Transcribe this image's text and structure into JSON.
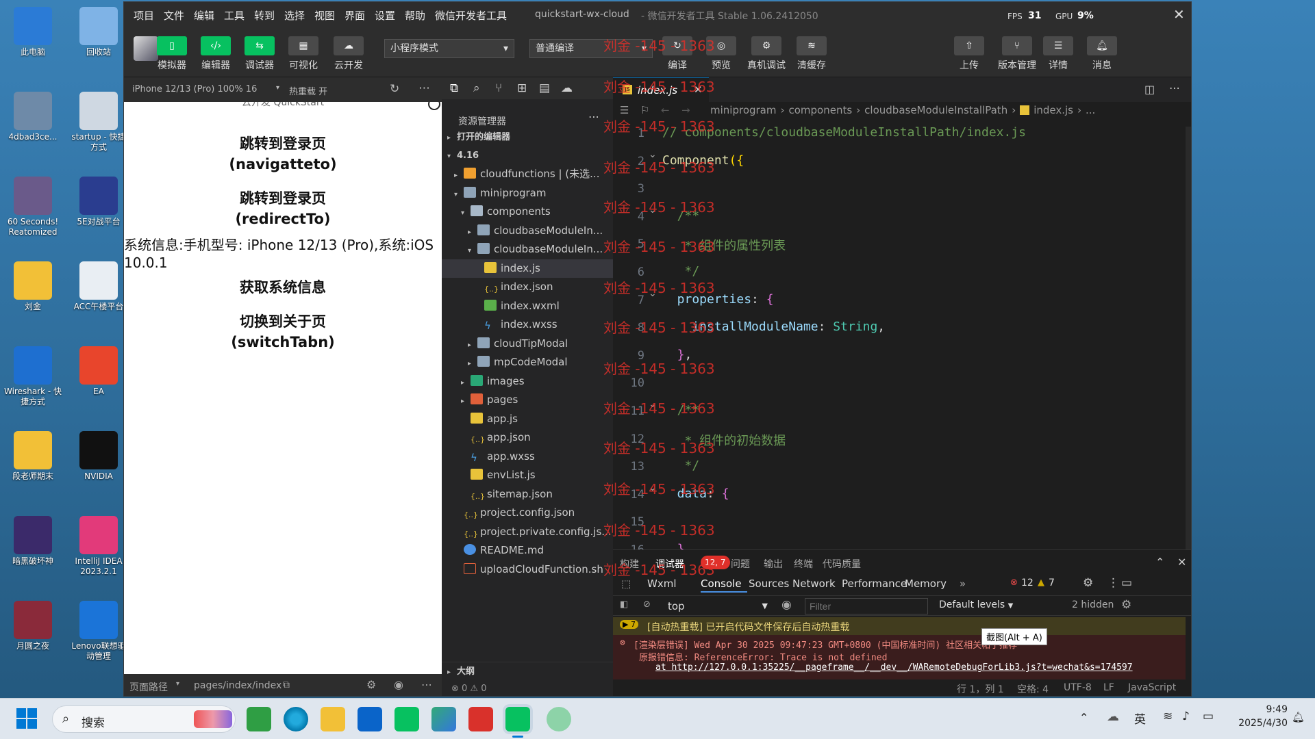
{
  "desktop_icons": [
    {
      "label": "此电脑",
      "icon": "monitor-icon"
    },
    {
      "label": "回收站",
      "icon": "recycle-bin-icon"
    },
    {
      "label": "4dbad3ce...",
      "icon": "user-photo-icon"
    },
    {
      "label": "startup - 快捷方式",
      "icon": "gear-shortcut-icon"
    },
    {
      "label": "60 Seconds! Reatomized",
      "icon": "game-icon"
    },
    {
      "label": "5E对战平台",
      "icon": "game-platform-icon"
    },
    {
      "label": "刘金",
      "icon": "folder-icon"
    },
    {
      "label": "ACC午楼平台",
      "icon": "app-icon"
    },
    {
      "label": "Wireshark - 快捷方式",
      "icon": "wireshark-icon"
    },
    {
      "label": "EA",
      "icon": "ea-icon"
    },
    {
      "label": "段老师期末",
      "icon": "folder-icon"
    },
    {
      "label": "NVIDIA",
      "icon": "nvidia-icon"
    },
    {
      "label": "暗黑破坏神",
      "icon": "game-icon"
    },
    {
      "label": "IntelliJ IDEA 2023.2.1",
      "icon": "intellij-icon"
    },
    {
      "label": "月圆之夜",
      "icon": "game-icon"
    },
    {
      "label": "Lenovo联想驱动管理",
      "icon": "lenovo-icon"
    }
  ],
  "titlebar": {
    "menus": [
      "项目",
      "文件",
      "编辑",
      "工具",
      "转到",
      "选择",
      "视图",
      "界面",
      "设置",
      "帮助",
      "微信开发者工具"
    ],
    "title": "quickstart-wx-cloud",
    "subtitle": "- 微信开发者工具 Stable 1.06.2412050",
    "fps_label": "FPS",
    "fps_value": "31",
    "gpu_label": "GPU",
    "gpu_value": "9%"
  },
  "toolbar": {
    "left_buttons": [
      "模拟器",
      "编辑器",
      "调试器",
      "可视化",
      "云开发"
    ],
    "mode_select": "小程序模式",
    "compile_select": "普通编译",
    "mid_buttons": [
      "编译",
      "预览",
      "真机调试",
      "清缓存"
    ],
    "right_buttons": [
      "上传",
      "版本管理",
      "详情",
      "消息"
    ]
  },
  "simulator": {
    "device": "iPhone 12/13 (Pro) 100% 16",
    "hot_reload": "热重载 开",
    "cut_top": "云开发 QuickStart",
    "items": [
      {
        "line1": "跳转到登录页",
        "line2": "(navigatteto)"
      },
      {
        "line1": "跳转到登录页",
        "line2": "(redirectTo)"
      }
    ],
    "sysinfo": "系统信息:手机型号:  iPhone 12/13 (Pro),系统:iOS 10.0.1",
    "get_sysinfo": "获取系统信息",
    "switch_line1": "切换到关于页",
    "switch_line2": "(switchTabn)",
    "footer_path_label": "页面路径",
    "footer_path": "pages/index/index"
  },
  "explorer": {
    "title": "资源管理器",
    "open_editors": "打开的编辑器",
    "root": "4.16",
    "tree": [
      {
        "label": "cloudfunctions | (未选...",
        "indent": 1,
        "arrow": "▸",
        "icon": "folder-orange"
      },
      {
        "label": "miniprogram",
        "indent": 1,
        "arrow": "▾",
        "icon": "folder"
      },
      {
        "label": "components",
        "indent": 2,
        "arrow": "▾",
        "icon": "folder-open"
      },
      {
        "label": "cloudbaseModuleIn...",
        "indent": 3,
        "arrow": "▸",
        "icon": "folder"
      },
      {
        "label": "cloudbaseModuleIn...",
        "indent": 3,
        "arrow": "▾",
        "icon": "folder"
      },
      {
        "label": "index.js",
        "indent": 4,
        "arrow": "",
        "icon": "js",
        "active": true
      },
      {
        "label": "index.json",
        "indent": 4,
        "arrow": "",
        "icon": "json"
      },
      {
        "label": "index.wxml",
        "indent": 4,
        "arrow": "",
        "icon": "wxml"
      },
      {
        "label": "index.wxss",
        "indent": 4,
        "arrow": "",
        "icon": "wxss"
      },
      {
        "label": "cloudTipModal",
        "indent": 3,
        "arrow": "▸",
        "icon": "folder"
      },
      {
        "label": "mpCodeModal",
        "indent": 3,
        "arrow": "▸",
        "icon": "folder"
      },
      {
        "label": "images",
        "indent": 2,
        "arrow": "▸",
        "icon": "folder-img"
      },
      {
        "label": "pages",
        "indent": 2,
        "arrow": "▸",
        "icon": "folder-red"
      },
      {
        "label": "app.js",
        "indent": 2,
        "arrow": "",
        "icon": "js"
      },
      {
        "label": "app.json",
        "indent": 2,
        "arrow": "",
        "icon": "json"
      },
      {
        "label": "app.wxss",
        "indent": 2,
        "arrow": "",
        "icon": "wxss"
      },
      {
        "label": "envList.js",
        "indent": 2,
        "arrow": "",
        "icon": "js"
      },
      {
        "label": "sitemap.json",
        "indent": 2,
        "arrow": "",
        "icon": "json"
      },
      {
        "label": "project.config.json",
        "indent": 1,
        "arrow": "",
        "icon": "json"
      },
      {
        "label": "project.private.config.js...",
        "indent": 1,
        "arrow": "",
        "icon": "json"
      },
      {
        "label": "README.md",
        "indent": 1,
        "arrow": "",
        "icon": "info"
      },
      {
        "label": "uploadCloudFunction.sh",
        "indent": 1,
        "arrow": "",
        "icon": "sh"
      }
    ],
    "outline": "大纲",
    "problems": "⊗ 0 ⚠ 0"
  },
  "editor": {
    "tab": "index.js",
    "breadcrumb": [
      "miniprogram",
      "components",
      "cloudbaseModuleInstallPath",
      "index.js",
      "..."
    ],
    "lines": [
      {
        "n": "1",
        "parts": [
          {
            "t": "// components/cloudbaseModuleInstallPath/index.js",
            "c": "#6a9955"
          }
        ]
      },
      {
        "n": "2",
        "parts": [
          {
            "t": "Component",
            "c": "#dcdcaa"
          },
          {
            "t": "({",
            "c": "#ffd700"
          }
        ]
      },
      {
        "n": "3",
        "parts": []
      },
      {
        "n": "4",
        "parts": [
          {
            "t": "  /**",
            "c": "#6a9955"
          }
        ]
      },
      {
        "n": "5",
        "parts": [
          {
            "t": "   * 组件的属性列表",
            "c": "#6a9955"
          }
        ]
      },
      {
        "n": "6",
        "parts": [
          {
            "t": "   */",
            "c": "#6a9955"
          }
        ]
      },
      {
        "n": "7",
        "parts": [
          {
            "t": "  properties",
            "c": "#9cdcfe"
          },
          {
            "t": ": ",
            "c": "#d4d4d4"
          },
          {
            "t": "{",
            "c": "#da70d6"
          }
        ]
      },
      {
        "n": "8",
        "parts": [
          {
            "t": "    installModuleName",
            "c": "#9cdcfe"
          },
          {
            "t": ": ",
            "c": "#d4d4d4"
          },
          {
            "t": "String",
            "c": "#4ec9b0"
          },
          {
            "t": ",",
            "c": "#d4d4d4"
          }
        ]
      },
      {
        "n": "9",
        "parts": [
          {
            "t": "  }",
            "c": "#da70d6"
          },
          {
            "t": ",",
            "c": "#d4d4d4"
          }
        ]
      },
      {
        "n": "10",
        "parts": []
      },
      {
        "n": "11",
        "parts": [
          {
            "t": "  /**",
            "c": "#6a9955"
          }
        ]
      },
      {
        "n": "12",
        "parts": [
          {
            "t": "   * 组件的初始数据",
            "c": "#6a9955"
          }
        ]
      },
      {
        "n": "13",
        "parts": [
          {
            "t": "   */",
            "c": "#6a9955"
          }
        ]
      },
      {
        "n": "14",
        "parts": [
          {
            "t": "  data",
            "c": "#9cdcfe"
          },
          {
            "t": ": ",
            "c": "#d4d4d4"
          },
          {
            "t": "{",
            "c": "#da70d6"
          }
        ]
      },
      {
        "n": "15",
        "parts": []
      },
      {
        "n": "16",
        "parts": [
          {
            "t": "  }",
            "c": "#da70d6"
          }
        ]
      }
    ],
    "watermark": "刘金 -145 - 1363"
  },
  "console": {
    "top_tabs": [
      "构建",
      "调试器",
      "问题",
      "输出",
      "终端",
      "代码质量"
    ],
    "error_badge": "12, 7",
    "dev_tabs": [
      "Wxml",
      "Console",
      "Sources",
      "Network",
      "Performance",
      "Memory"
    ],
    "err_count": "12",
    "warn_count": "7",
    "context": "top",
    "filter_placeholder": "Filter",
    "levels": "Default levels",
    "hidden": "2 hidden",
    "msg_warn": "[自动热重载] 已开启代码文件保存后自动热重载",
    "msg_err1": "[渲染层错误] Wed Apr 30 2025 09:47:23 GMT+0800 (中国标准时间) 社区相关帖子推荐",
    "msg_err2": "原报错信息: ReferenceError: Trace is not defined",
    "msg_err3": "at http://127.0.0.1:35225/__pageframe__/__dev__/WARemoteDebugForLib3.js?t=wechat&s=174597",
    "tooltip": "截图(Alt + A)"
  },
  "status": {
    "pos": "行 1，列 1",
    "spaces": "空格: 4",
    "enc": "UTF-8",
    "eol": "LF",
    "lang": "JavaScript"
  },
  "taskbar": {
    "search": "搜索",
    "ime": "英",
    "time": "9:49",
    "date": "2025/4/30"
  },
  "colors": {
    "green": "#07c160",
    "accent": "#0e639c",
    "error": "#f14c4c",
    "warning": "#cca700"
  }
}
